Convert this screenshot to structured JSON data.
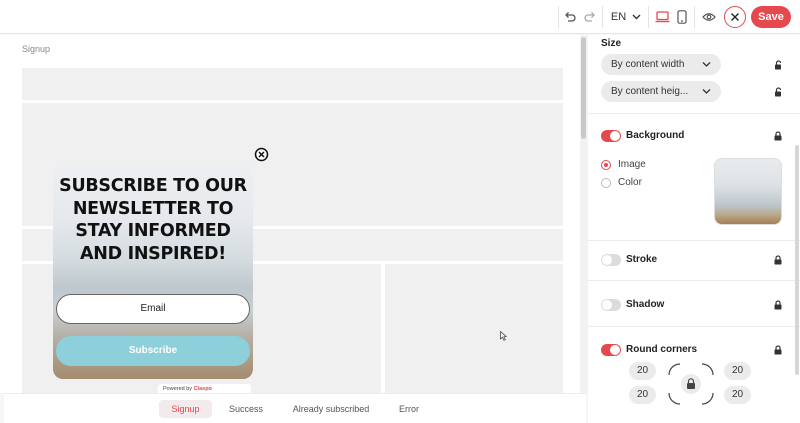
{
  "topbar": {
    "language": "EN",
    "save_label": "Save"
  },
  "canvas": {
    "breadcrumb": "Signup",
    "popup": {
      "title": "SUBSCRIBE TO OUR NEWSLETTER TO STAY INFORMED AND INSPIRED!",
      "email_placeholder": "Email",
      "subscribe_label": "Subscribe",
      "powered_by": "Powered by",
      "brand": "Claspo"
    }
  },
  "tabs": [
    {
      "label": "Signup",
      "active": true
    },
    {
      "label": "Success",
      "active": false
    },
    {
      "label": "Already subscribed",
      "active": false
    },
    {
      "label": "Error",
      "active": false
    }
  ],
  "panel": {
    "size": {
      "label": "Size",
      "width_option": "By content width",
      "height_option": "By content heig..."
    },
    "background": {
      "label": "Background",
      "enabled": true,
      "options": [
        {
          "label": "Image",
          "selected": true
        },
        {
          "label": "Color",
          "selected": false
        }
      ]
    },
    "stroke": {
      "label": "Stroke",
      "enabled": false
    },
    "shadow": {
      "label": "Shadow",
      "enabled": false
    },
    "round_corners": {
      "label": "Round corners",
      "enabled": true,
      "top_left": "20",
      "top_right": "20",
      "bottom_left": "20",
      "bottom_right": "20"
    }
  },
  "colors": {
    "accent": "#e5484d",
    "subscribe_button": "#8dcfdb"
  },
  "icons": [
    "undo-icon",
    "redo-icon",
    "chevron-down-icon",
    "desktop-icon",
    "mobile-icon",
    "eye-icon",
    "close-icon",
    "lock-icon",
    "unlock-icon"
  ]
}
